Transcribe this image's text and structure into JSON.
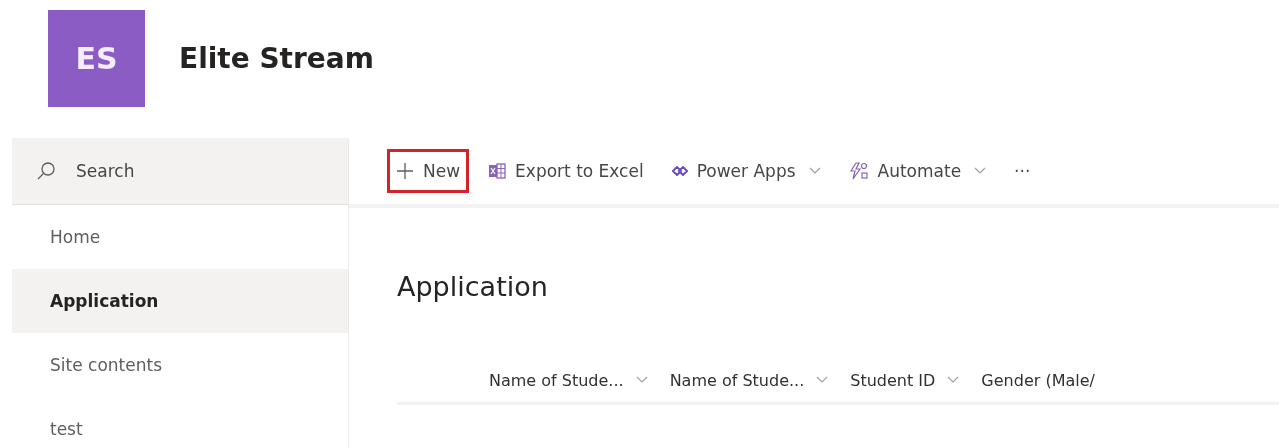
{
  "site": {
    "logo": "ES",
    "title": "Elite Stream"
  },
  "sidebar": {
    "search": {
      "placeholder": "Search"
    },
    "items": [
      {
        "label": "Home",
        "selected": false
      },
      {
        "label": "Application",
        "selected": true
      },
      {
        "label": "Site contents",
        "selected": false
      },
      {
        "label": "test",
        "selected": false
      }
    ]
  },
  "commands": [
    {
      "kind": "new",
      "label": "New",
      "highlighted": true,
      "dropdown": false
    },
    {
      "kind": "excel",
      "label": "Export to Excel",
      "highlighted": false,
      "dropdown": false
    },
    {
      "kind": "powerapps",
      "label": "Power Apps",
      "highlighted": false,
      "dropdown": true
    },
    {
      "kind": "automate",
      "label": "Automate",
      "highlighted": false,
      "dropdown": true
    },
    {
      "kind": "more",
      "label": "···",
      "highlighted": false,
      "dropdown": false
    }
  ],
  "list": {
    "title": "Application",
    "columns": [
      {
        "label": "Name of Stude...",
        "dropdown": true
      },
      {
        "label": "Name of Stude...",
        "dropdown": true
      },
      {
        "label": "Student ID",
        "dropdown": true
      },
      {
        "label": "Gender (Male/",
        "dropdown": false
      }
    ]
  }
}
